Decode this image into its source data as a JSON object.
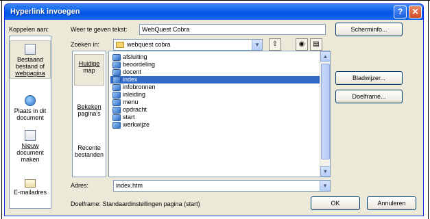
{
  "window": {
    "title": "Hyperlink invoegen"
  },
  "link_to": {
    "label": "Koppelen aan:",
    "items": [
      {
        "lines": [
          "Bestaand",
          "bestand of",
          "webpagina"
        ],
        "icon": "document-icon",
        "selected": true
      },
      {
        "lines": [
          "Plaats in dit",
          "document"
        ],
        "icon": "place-in-document-icon",
        "selected": false
      },
      {
        "lines": [
          "Nieuw",
          "document",
          "maken"
        ],
        "icon": "new-document-icon",
        "selected": false
      },
      {
        "lines": [
          "E-mailadres"
        ],
        "icon": "email-icon",
        "selected": false
      }
    ]
  },
  "display_text": {
    "label": "Weer te geven tekst:",
    "value": "WebQuest Cobra"
  },
  "screentip_button": "Scherminfo...",
  "look_in": {
    "label": "Zoeken in:",
    "value": "webquest cobra"
  },
  "subnav": [
    {
      "lines": [
        "Huidige",
        "map"
      ],
      "selected": true
    },
    {
      "lines": [
        "Bekeken",
        "pagina's"
      ],
      "selected": false
    },
    {
      "lines": [
        "Recente",
        "bestanden"
      ],
      "selected": false
    }
  ],
  "files": [
    "afsluiting",
    "beoordeling",
    "docent",
    "index",
    "infobronnen",
    "inleiding",
    "menu",
    "opdracht",
    "start",
    "werkwijze"
  ],
  "selected_file": "index",
  "bookmark_button": "Bladwijzer...",
  "target_frame_button": "Doelframe...",
  "address": {
    "label": "Adres:",
    "value": "index.htm"
  },
  "status": "Doelframe: Standaardinstellingen pagina (start)",
  "ok_button": "OK",
  "cancel_button": "Annuleren"
}
